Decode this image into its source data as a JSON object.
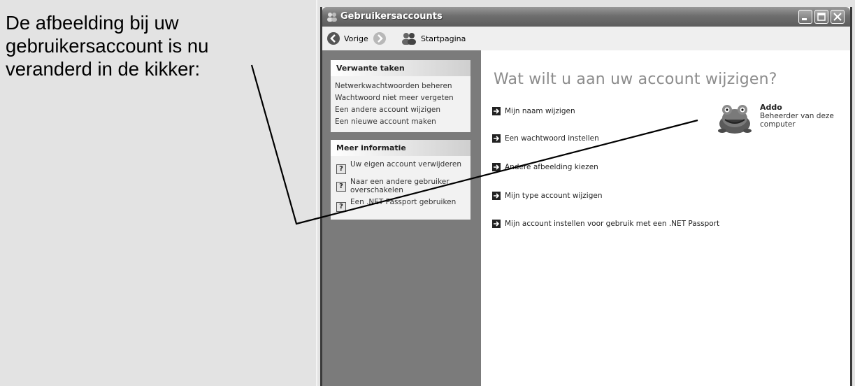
{
  "caption": "De afbeelding bij uw gebruikersaccount is nu veranderd in de kikker:",
  "window": {
    "title": "Gebruikersaccounts",
    "toolbar": {
      "back_label": "Vorige",
      "home_label": "Startpagina"
    }
  },
  "sidebar": {
    "related_tasks": {
      "title": "Verwante taken",
      "items": [
        "Netwerkwachtwoorden beheren",
        "Wachtwoord niet meer vergeten",
        "Een andere account wijzigen",
        "Een nieuwe account maken"
      ]
    },
    "more_info": {
      "title": "Meer informatie",
      "items": [
        "Uw eigen account verwijderen",
        "Naar een andere gebruiker overschakelen",
        "Een .NET Passport gebruiken"
      ]
    }
  },
  "main": {
    "heading": "Wat wilt u aan uw account wijzigen?",
    "links": [
      "Mijn naam wijzigen",
      "Een wachtwoord instellen",
      "Andere afbeelding kiezen",
      "Mijn type account wijzigen",
      "Mijn account instellen voor gebruik met een .NET Passport"
    ],
    "account": {
      "name": "Addo",
      "role": "Beheerder van deze computer",
      "picture": "frog-icon"
    }
  },
  "colors": {
    "titlebar": "#6e6e6e",
    "sidebar": "#7b7b7b",
    "heading": "#8c8c8c"
  }
}
